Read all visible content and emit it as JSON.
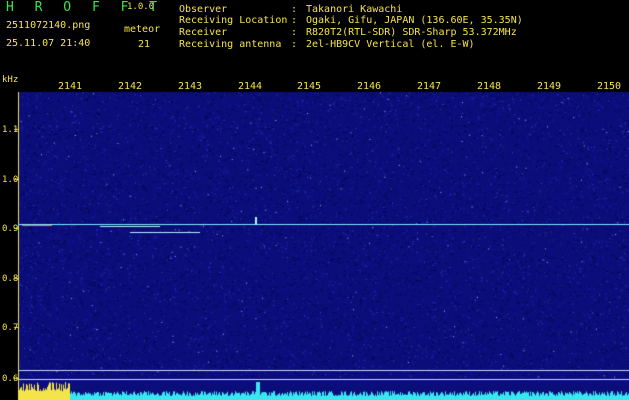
{
  "app": {
    "title": "H R O F F T",
    "version": "1.0.0"
  },
  "capture": {
    "file": "2511072140.png",
    "timestamp": "25.11.07 21:40",
    "meteor_label": "meteor",
    "meteor_count": "21"
  },
  "info": [
    {
      "key": "Observer",
      "value": "Takanori Kawachi"
    },
    {
      "key": "Receiving Location",
      "value": "Ogaki, Gifu, JAPAN (136.60E, 35.35N)"
    },
    {
      "key": "Receiver",
      "value": "R820T2(RTL-SDR) SDR-Sharp 53.372MHz"
    },
    {
      "key": "Receiving antenna",
      "value": "2el-HB9CV Vertical (el. E-W)"
    }
  ],
  "info_sep": ":",
  "axis": {
    "unit": "kHz",
    "x_ticks": [
      "2141",
      "2142",
      "2143",
      "2144",
      "2145",
      "2146",
      "2147",
      "2148",
      "2149",
      "2150"
    ],
    "y_ticks": [
      "1.1",
      "1.0",
      "0.9",
      "0.8",
      "0.7",
      "0.6"
    ]
  },
  "colors": {
    "background": "#000000",
    "spectrum": "#0b0e7a",
    "text": "#f5e34a",
    "title": "#3fe04a",
    "signal": "#7fe8ff",
    "level": "#38e8f0"
  }
}
